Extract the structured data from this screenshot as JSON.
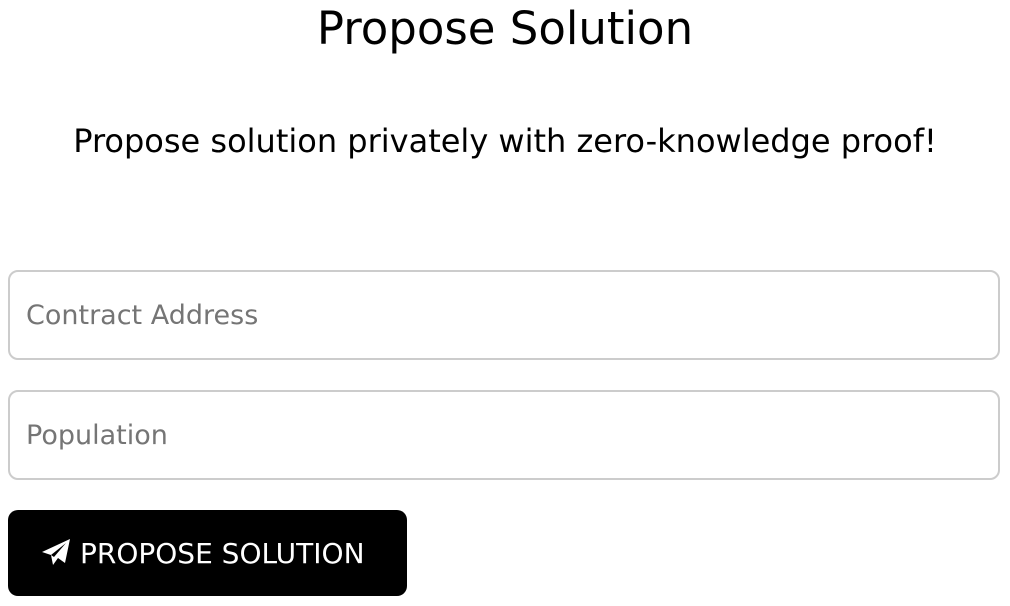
{
  "page": {
    "title": "Propose Solution",
    "subtitle": "Propose solution privately with zero-knowledge proof!"
  },
  "form": {
    "contract_address": {
      "value": "",
      "placeholder": "Contract Address"
    },
    "population": {
      "value": "",
      "placeholder": "Population"
    },
    "submit": {
      "label": "PROPOSE SOLUTION",
      "icon": "paper-plane-icon"
    }
  },
  "colors": {
    "background": "#ffffff",
    "text": "#000000",
    "field_border": "#cccccc",
    "placeholder": "#757575",
    "button_bg": "#000000",
    "button_text": "#ffffff"
  }
}
